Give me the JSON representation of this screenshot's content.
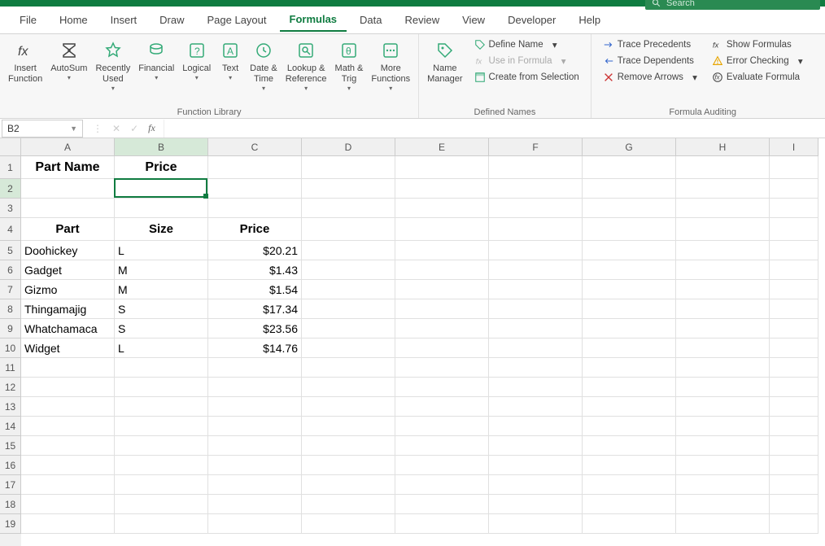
{
  "title_bar": {
    "search_placeholder": "Search"
  },
  "menu": {
    "tabs": [
      "File",
      "Home",
      "Insert",
      "Draw",
      "Page Layout",
      "Formulas",
      "Data",
      "Review",
      "View",
      "Developer",
      "Help"
    ],
    "active": "Formulas"
  },
  "ribbon": {
    "insert_function": "Insert\nFunction",
    "autosum": "AutoSum",
    "recently": "Recently\nUsed",
    "financial": "Financial",
    "logical": "Logical",
    "text": "Text",
    "datetime": "Date &\nTime",
    "lookup": "Lookup &\nReference",
    "math": "Math &\nTrig",
    "more": "More\nFunctions",
    "group_lib": "Function Library",
    "name_mgr": "Name\nManager",
    "define_name": "Define Name",
    "use_in_formula": "Use in Formula",
    "create_sel": "Create from Selection",
    "group_names": "Defined Names",
    "trace_prec": "Trace Precedents",
    "trace_dep": "Trace Dependents",
    "remove_arrows": "Remove Arrows",
    "show_formulas": "Show Formulas",
    "error_check": "Error Checking",
    "eval_formula": "Evaluate Formula",
    "group_audit": "Formula Auditing"
  },
  "namebox": "B2",
  "columns": [
    "A",
    "B",
    "C",
    "D",
    "E",
    "F",
    "G",
    "H",
    "I"
  ],
  "rows": [
    "1",
    "2",
    "3",
    "4",
    "5",
    "6",
    "7",
    "8",
    "9",
    "10",
    "11",
    "12",
    "13",
    "14",
    "15",
    "16",
    "17",
    "18",
    "19"
  ],
  "sheet": {
    "r1": {
      "A": "Part Name",
      "B": "Price"
    },
    "r4": {
      "A": "Part",
      "B": "Size",
      "C": "Price"
    },
    "r5": {
      "A": "Doohickey",
      "B": "L",
      "C": "$20.21"
    },
    "r6": {
      "A": "Gadget",
      "B": "M",
      "C": "$1.43"
    },
    "r7": {
      "A": "Gizmo",
      "B": "M",
      "C": "$1.54"
    },
    "r8": {
      "A": "Thingamajig",
      "B": "S",
      "C": "$17.34"
    },
    "r9": {
      "A": "Whatchamaca",
      "B": "S",
      "C": "$23.56"
    },
    "r10": {
      "A": "Widget",
      "B": "L",
      "C": "$14.76"
    }
  },
  "active_cell": {
    "col": "B",
    "row": 2
  }
}
